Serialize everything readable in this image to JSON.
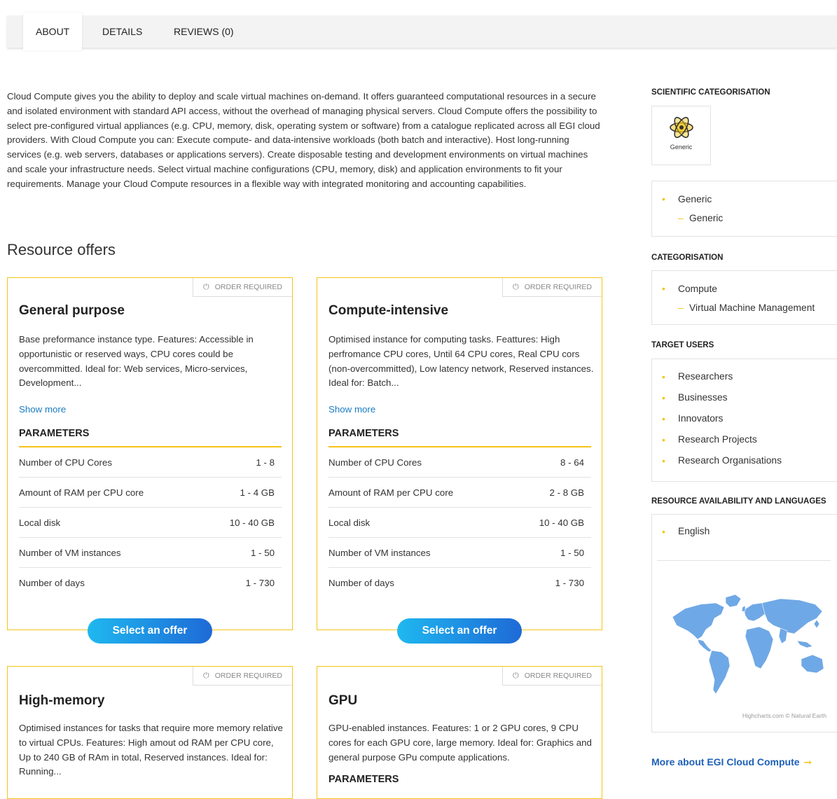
{
  "tabs": [
    {
      "label": "ABOUT",
      "active": true
    },
    {
      "label": "DETAILS",
      "active": false
    },
    {
      "label": "REVIEWS (0)",
      "active": false
    }
  ],
  "description": "Cloud Compute gives you the ability to deploy and scale virtual machines on-demand. It offers guaranteed computational resources in a secure and isolated environment with standard API access, without the overhead of managing physical servers. Cloud Compute offers the possibility to select pre-configured virtual appliances (e.g. CPU, memory, disk, operating system or software) from a catalogue replicated across all EGI cloud providers. With Cloud Compute you can: Execute compute- and data-intensive workloads (both batch and interactive). Host long-running services (e.g. web servers, databases or applications servers). Create disposable testing and development environments on virtual machines and scale your infrastructure needs. Select virtual machine configurations (CPU, memory, disk) and application environments to fit your requirements. Manage your Cloud Compute resources in a flexible way with integrated monitoring and accounting capabilities.",
  "offers_title": "Resource offers",
  "offers": [
    {
      "badge": "ORDER REQUIRED",
      "title": "General purpose",
      "description": "Base preformance instance type. Features: Accessible in opportunistic or reserved ways, CPU cores could be overcommitted. Ideal for: Web services, Micro-services, Development...",
      "show_more": "Show more",
      "params_title": "PARAMETERS",
      "params": [
        {
          "name": "Number of CPU Cores",
          "value": "1 - 8"
        },
        {
          "name": "Amount of RAM per CPU core",
          "value": "1 - 4 GB"
        },
        {
          "name": "Local disk",
          "value": "10 - 40 GB"
        },
        {
          "name": "Number of VM instances",
          "value": "1 - 50"
        },
        {
          "name": "Number of days",
          "value": "1 - 730"
        }
      ],
      "button": "Select an offer"
    },
    {
      "badge": "ORDER REQUIRED",
      "title": "Compute-intensive",
      "description": "Optimised instance for computing tasks. Feattures: High perfromance CPU cores, Until 64 CPU cores, Real CPU cors (non-overcommitted), Low latency network, Reserved instances. Ideal for: Batch...",
      "show_more": "Show more",
      "params_title": "PARAMETERS",
      "params": [
        {
          "name": "Number of CPU Cores",
          "value": "8 - 64"
        },
        {
          "name": "Amount of RAM per CPU core",
          "value": "2 - 8 GB"
        },
        {
          "name": "Local disk",
          "value": "10 - 40 GB"
        },
        {
          "name": "Number of VM instances",
          "value": "1 - 50"
        },
        {
          "name": "Number of days",
          "value": "1 - 730"
        }
      ],
      "button": "Select an offer"
    },
    {
      "badge": "ORDER REQUIRED",
      "title": "High-memory",
      "description": "Optimised instances for tasks that require more memory relative to virtual CPUs. Features: High amout od RAM per CPU core, Up to 240 GB of RAm in total, Reserved instances. Ideal for: Running..."
    },
    {
      "badge": "ORDER REQUIRED",
      "title": "GPU",
      "description": "GPU-enabled instances. Features: 1 or 2 GPU cores, 9 CPU cores for each GPU core, large memory. Ideal for: Graphics and general purpose GPu compute applications.",
      "params_title": "PARAMETERS"
    }
  ],
  "sidebar": {
    "scientific_title": "SCIENTIFIC CATEGORISATION",
    "scientific_icon_label": "Generic",
    "scientific_icon": "atom-icon",
    "scientific_list": {
      "item": "Generic",
      "sub": "Generic"
    },
    "categorisation_title": "CATEGORISATION",
    "categorisation_list": {
      "item": "Compute",
      "sub": "Virtual Machine Management"
    },
    "target_users_title": "TARGET USERS",
    "target_users": [
      "Researchers",
      "Businesses",
      "Innovators",
      "Research Projects",
      "Research Organisations"
    ],
    "availability_title": "RESOURCE AVAILABILITY AND LANGUAGES",
    "languages": [
      "English"
    ],
    "map_credit": "Highcharts.com © Natural Earth",
    "more_link": "More about EGI Cloud Compute",
    "accent_color": "#f5c518",
    "map_color": "#6fa8e6"
  }
}
